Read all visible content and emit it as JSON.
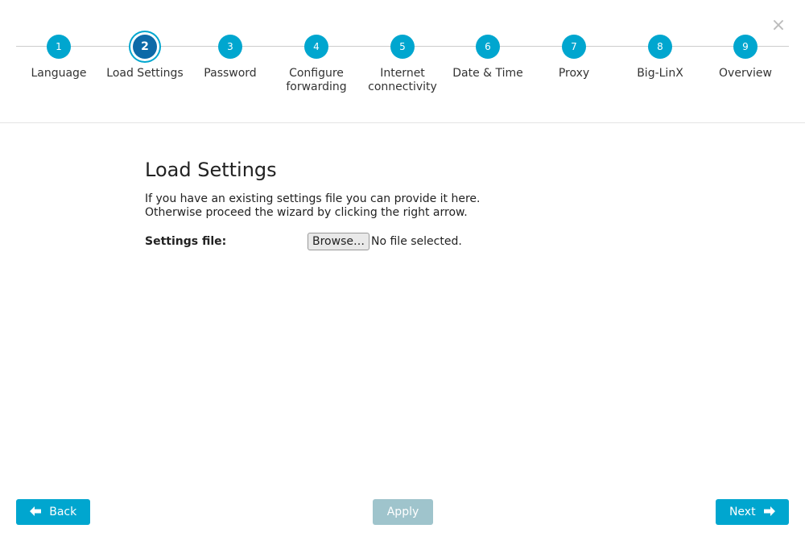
{
  "close_icon": "×",
  "steps": [
    {
      "number": "1",
      "label": "Language"
    },
    {
      "number": "2",
      "label": "Load Settings"
    },
    {
      "number": "3",
      "label": "Password"
    },
    {
      "number": "4",
      "label": "Configure forwarding"
    },
    {
      "number": "5",
      "label": "Internet connectivity"
    },
    {
      "number": "6",
      "label": "Date & Time"
    },
    {
      "number": "7",
      "label": "Proxy"
    },
    {
      "number": "8",
      "label": "Big-LinX"
    },
    {
      "number": "9",
      "label": "Overview"
    }
  ],
  "active_step": 2,
  "main": {
    "title": "Load Settings",
    "description_line1": "If you have an existing settings file you can provide it here.",
    "description_line2": "Otherwise proceed the wizard by clicking the right arrow.",
    "settings_label": "Settings file:",
    "browse_label": "Browse…",
    "file_status": "No file selected."
  },
  "footer": {
    "back_label": "Back",
    "apply_label": "Apply",
    "next_label": "Next"
  },
  "colors": {
    "accent": "#00a6cf",
    "active_step": "#0d6aa8",
    "disabled": "#9fc4cc"
  },
  "icons": {
    "back": "arrow-left-icon",
    "next": "arrow-right-icon",
    "close": "close-icon"
  }
}
